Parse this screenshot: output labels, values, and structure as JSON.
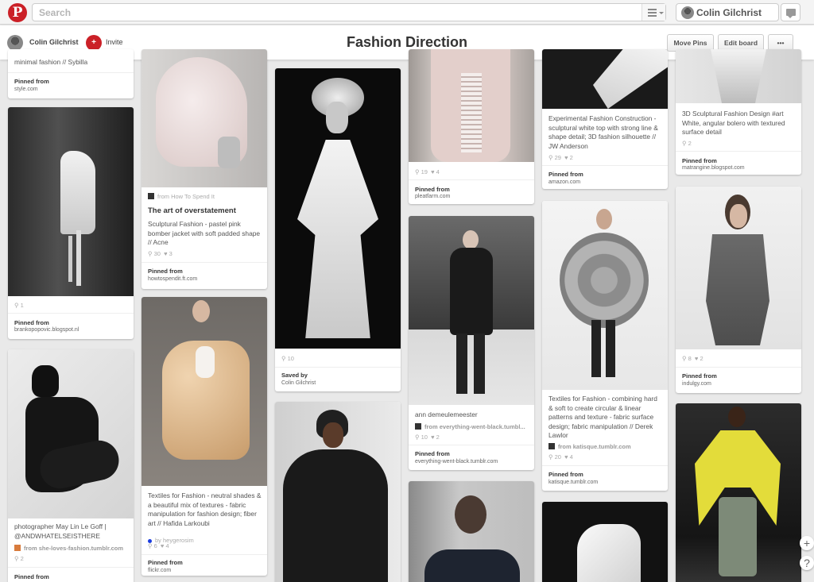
{
  "topbar": {
    "logo": "P",
    "search_placeholder": "Search",
    "user_name": "Colin Gilchrist",
    "icons": [
      "pinterest-logo",
      "menu-icon",
      "chevron-down-icon",
      "avatar",
      "notifications-icon"
    ]
  },
  "board": {
    "owner": "Colin Gilchrist",
    "invite_label": "Invite",
    "invite_icon": "add-person-icon",
    "title": "Fashion Direction",
    "move_pins_label": "Move Pins",
    "edit_board_label": "Edit board",
    "more_label": "•••"
  },
  "colors": {
    "brand_red": "#cb2027",
    "page_bg": "#e9e9e9"
  },
  "pins": {
    "c1p1": {
      "desc": "minimal fashion // Sybilla",
      "label": "Pinned from",
      "source": "style.com"
    },
    "c1p2": {
      "repins": "1",
      "label": "Pinned from",
      "source": "brankopopovic.blogspot.nl"
    },
    "c1p3": {
      "desc": "photographer May Lin Le Goff | @ANDWHATELSEISTHERE",
      "from": "from she-loves-fashion.tumblr.com",
      "repins": "2",
      "label": "Pinned from"
    },
    "c2p1": {
      "from": "from How To Spend It",
      "title": "The art of overstatement",
      "desc": "Sculptural Fashion - pastel pink bomber jacket with soft padded shape // Acne",
      "repins": "30",
      "likes": "3",
      "label": "Pinned from",
      "source": "howtospendit.ft.com"
    },
    "c2p2": {
      "desc": "Textiles for Fashion - neutral shades & a beautiful mix of textures - fabric manipulation for fashion design; fiber art // Hafida Larkoubi",
      "from": "by heygerosim",
      "repins": "6",
      "likes": "4",
      "label": "Pinned from",
      "source": "flickr.com"
    },
    "c3p1": {
      "repins": "10",
      "label": "Saved by",
      "source": "Colin Gilchrist"
    },
    "c4p1": {
      "repins": "19",
      "likes": "4",
      "label": "Pinned from",
      "source": "pleatfarm.com"
    },
    "c4p2": {
      "desc": "ann demeulemeester",
      "from": "from everything-went-black.tumbl...",
      "repins": "10",
      "likes": "2",
      "label": "Pinned from",
      "source": "everything-went-black.tumblr.com"
    },
    "c5p1": {
      "desc": "Experimental Fashion Construction - sculptural white top with strong line & shape detail; 3D fashion silhouette // JW Anderson",
      "repins": "29",
      "likes": "2",
      "label": "Pinned from",
      "source": "amazon.com"
    },
    "c5p2": {
      "desc": "Textiles for Fashion - combining hard & soft to create circular & linear patterns and texture - fabric surface design; fabric manipulation // Derek Lawlor",
      "from": "from katisque.tumblr.com",
      "repins": "20",
      "likes": "4",
      "label": "Pinned from",
      "source": "katisque.tumblr.com"
    },
    "c6p1": {
      "desc": "3D Sculptural Fashion Design #art White, angular bolero with textured surface detail",
      "repins": "2",
      "label": "Pinned from",
      "source": "matrangine.blogspot.com"
    },
    "c6p2": {
      "repins": "8",
      "likes": "2",
      "label": "Pinned from",
      "source": "indulgy.com"
    }
  },
  "side_buttons": {
    "plus": "+",
    "help": "?"
  }
}
